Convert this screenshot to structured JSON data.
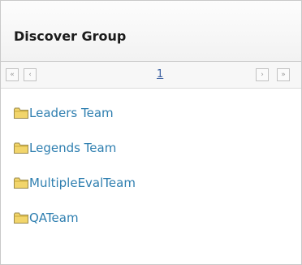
{
  "panel": {
    "title": "Discover Group"
  },
  "pager": {
    "first_glyph": "«",
    "prev_glyph": "‹",
    "next_glyph": "›",
    "last_glyph": "»",
    "current_page": "1"
  },
  "groups": [
    {
      "label": "Leaders Team",
      "icon": "folder-icon"
    },
    {
      "label": "Legends Team",
      "icon": "folder-icon"
    },
    {
      "label": "MultipleEvalTeam",
      "icon": "folder-icon"
    },
    {
      "label": "QATeam",
      "icon": "folder-icon"
    }
  ],
  "colors": {
    "link": "#2f7fb0",
    "folder": "#f2d56b",
    "border": "#c9c9c9"
  }
}
